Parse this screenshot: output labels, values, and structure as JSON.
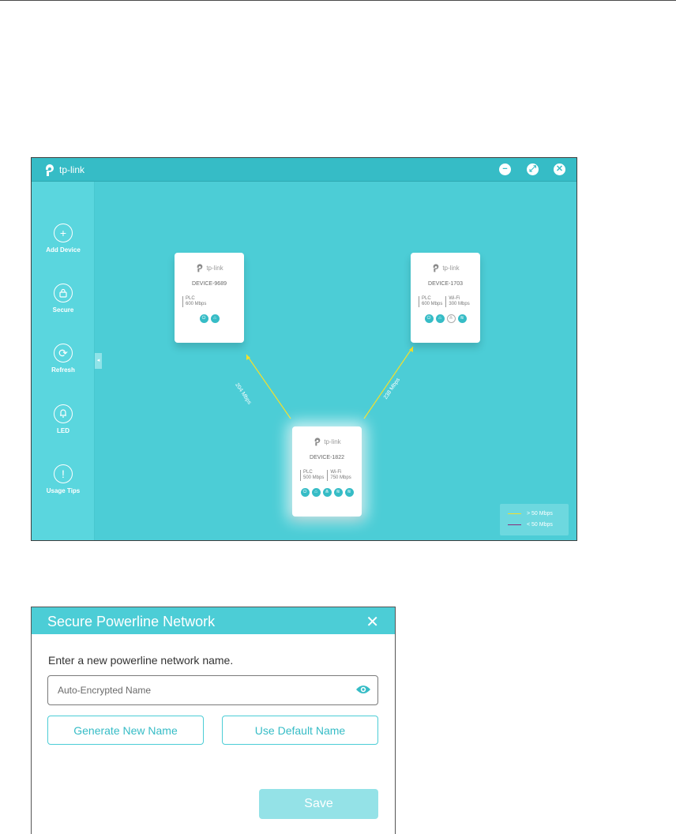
{
  "app": {
    "brand": "tp-link",
    "window_controls": {
      "minimize": "−",
      "restore": "⤢",
      "close": "✕"
    },
    "sidebar": [
      {
        "label": "Add Device",
        "glyph": "+",
        "icon": "plus-icon"
      },
      {
        "label": "Secure",
        "glyph": "🔒",
        "icon": "lock-icon"
      },
      {
        "label": "Refresh",
        "glyph": "⟳",
        "icon": "refresh-icon"
      },
      {
        "label": "LED",
        "glyph": "☼",
        "icon": "led-icon"
      },
      {
        "label": "Usage Tips",
        "glyph": "!",
        "icon": "tips-icon"
      }
    ],
    "collapse_glyph": "◂",
    "devices": [
      {
        "name": "DEVICE-9689",
        "specs": [
          {
            "label": "PLC",
            "value": "600 Mbps"
          }
        ]
      },
      {
        "name": "DEVICE-1703",
        "specs": [
          {
            "label": "PLC",
            "value": "600 Mbps"
          },
          {
            "label": "Wi-Fi",
            "value": "300 Mbps"
          }
        ]
      },
      {
        "name": "DEVICE-1822",
        "specs": [
          {
            "label": "PLC",
            "value": "500 Mbps"
          },
          {
            "label": "Wi-Fi",
            "value": "750 Mbps"
          }
        ]
      }
    ],
    "links": [
      {
        "rate": "204 Mbps",
        "color": "#f5e02a"
      },
      {
        "rate": "238 Mbps",
        "color": "#f5e02a"
      }
    ],
    "legend": [
      {
        "text": "> 50 Mbps",
        "color": "#f5e02a"
      },
      {
        "text": "< 50 Mbps",
        "color": "#8a2a7a"
      }
    ],
    "accent_color": "#4ccdd6"
  },
  "dialog": {
    "title": "Secure Powerline Network",
    "close_glyph": "✕",
    "prompt": "Enter a new powerline network name.",
    "name_input": {
      "placeholder": "Auto-Encrypted Name",
      "value": ""
    },
    "generate_button": "Generate New Name",
    "default_button": "Use Default Name",
    "save_button": "Save"
  }
}
